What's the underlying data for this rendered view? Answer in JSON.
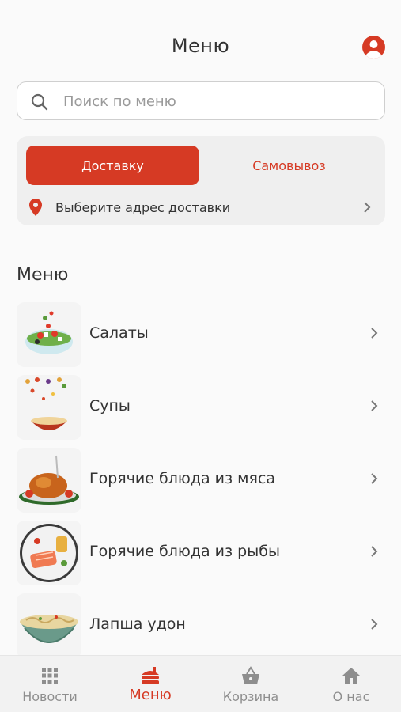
{
  "header": {
    "title": "Меню"
  },
  "search": {
    "placeholder": "Поиск по меню",
    "value": ""
  },
  "delivery": {
    "options": [
      "Доставку",
      "Самовывоз"
    ],
    "selected": "Доставку",
    "address_prompt": "Выберите адрес доставки"
  },
  "menu": {
    "section_title": "Меню",
    "items": [
      {
        "label": "Салаты",
        "icon": "salad-image"
      },
      {
        "label": "Супы",
        "icon": "soup-image"
      },
      {
        "label": "Горячие блюда из мяса",
        "icon": "roast-chicken-image"
      },
      {
        "label": "Горячие блюда из рыбы",
        "icon": "fish-plate-image"
      },
      {
        "label": "Лапша удон",
        "icon": "noodle-bowl-image"
      }
    ]
  },
  "bottom_nav": {
    "items": [
      {
        "label": "Новости",
        "icon": "grid-icon",
        "active": false
      },
      {
        "label": "Меню",
        "icon": "burger-icon",
        "active": true
      },
      {
        "label": "Корзина",
        "icon": "basket-icon",
        "active": false
      },
      {
        "label": "О нас",
        "icon": "home-icon",
        "active": false
      }
    ]
  },
  "colors": {
    "accent": "#d63a24",
    "inactive_nav": "#8e8e8e",
    "text": "#333333"
  }
}
